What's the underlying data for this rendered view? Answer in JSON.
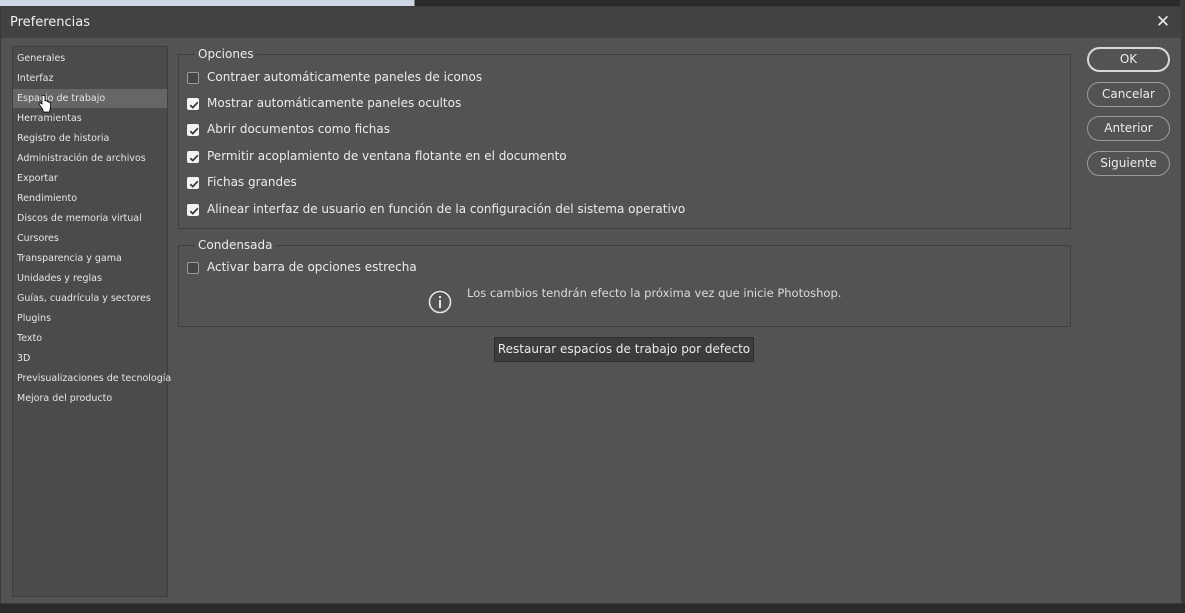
{
  "window": {
    "title": "Preferencias",
    "close_glyph": "✕"
  },
  "sidebar": {
    "items": [
      {
        "label": "Generales"
      },
      {
        "label": "Interfaz"
      },
      {
        "label": "Espacio de trabajo",
        "selected": true
      },
      {
        "label": "Herramientas"
      },
      {
        "label": "Registro de historia"
      },
      {
        "label": "Administración de archivos"
      },
      {
        "label": "Exportar"
      },
      {
        "label": "Rendimiento"
      },
      {
        "label": "Discos de memoria virtual"
      },
      {
        "label": "Cursores"
      },
      {
        "label": "Transparencia y gama"
      },
      {
        "label": "Unidades y reglas"
      },
      {
        "label": "Guías, cuadrícula y sectores"
      },
      {
        "label": "Plugins"
      },
      {
        "label": "Texto"
      },
      {
        "label": "3D"
      },
      {
        "label": "Previsualizaciones de tecnología"
      },
      {
        "label": "Mejora del producto"
      }
    ]
  },
  "opciones": {
    "legend": "Opciones",
    "items": [
      {
        "label": "Contraer automáticamente paneles de iconos",
        "checked": false
      },
      {
        "label": "Mostrar automáticamente paneles ocultos",
        "checked": true
      },
      {
        "label": "Abrir documentos como fichas",
        "checked": true
      },
      {
        "label": "Permitir acoplamiento de ventana flotante en el documento",
        "checked": true
      },
      {
        "label": "Fichas grandes",
        "checked": true
      },
      {
        "label": "Alinear interfaz de usuario en función de la configuración del sistema operativo",
        "checked": true
      }
    ]
  },
  "condensada": {
    "legend": "Condensada",
    "items": [
      {
        "label": "Activar barra de opciones estrecha",
        "checked": false
      }
    ],
    "info_text": "Los cambios tendrán efecto la próxima vez que inicie Photoshop."
  },
  "restore_button": "Restaurar espacios de trabajo por defecto",
  "buttons": {
    "ok": "OK",
    "cancel": "Cancelar",
    "previous": "Anterior",
    "next": "Siguiente"
  },
  "colors": {
    "dialog_bg": "#535353",
    "titlebar_bg": "#424242",
    "selected_item": "#666666"
  }
}
